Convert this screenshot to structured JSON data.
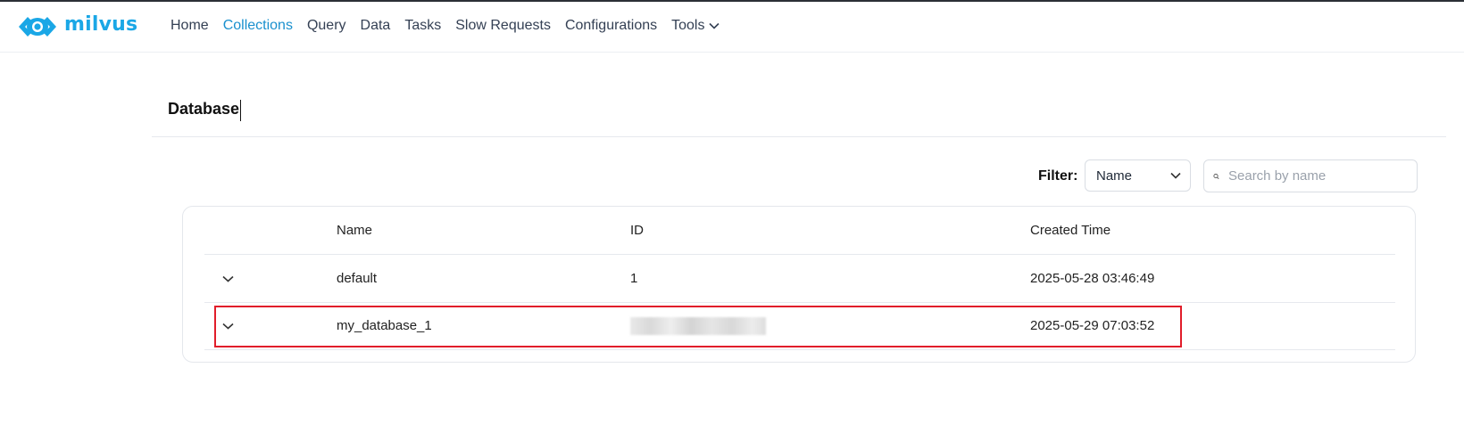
{
  "app": {
    "logo_text": "milvus",
    "brand_color": "#1aa7e6",
    "logo_icon": "eye-icon"
  },
  "nav": {
    "items": [
      {
        "label": "Home"
      },
      {
        "label": "Collections",
        "active": true
      },
      {
        "label": "Query"
      },
      {
        "label": "Data"
      },
      {
        "label": "Tasks"
      },
      {
        "label": "Slow Requests"
      },
      {
        "label": "Configurations"
      },
      {
        "label": "Tools",
        "dropdown": true
      }
    ]
  },
  "page": {
    "title": "Database"
  },
  "filter": {
    "label": "Filter:",
    "selected": "Name",
    "search_placeholder": "Search by name",
    "search_value": ""
  },
  "table": {
    "columns": [
      "Name",
      "ID",
      "Created Time"
    ],
    "rows": [
      {
        "name": "default",
        "id": "1",
        "created": "2025-05-28 03:46:49"
      },
      {
        "name": "my_database_1",
        "id": "",
        "id_redacted": true,
        "created": "2025-05-29 07:03:52",
        "highlighted": true
      }
    ]
  },
  "colors": {
    "active_nav": "#1a90ce",
    "highlight": "#e11d2a"
  }
}
